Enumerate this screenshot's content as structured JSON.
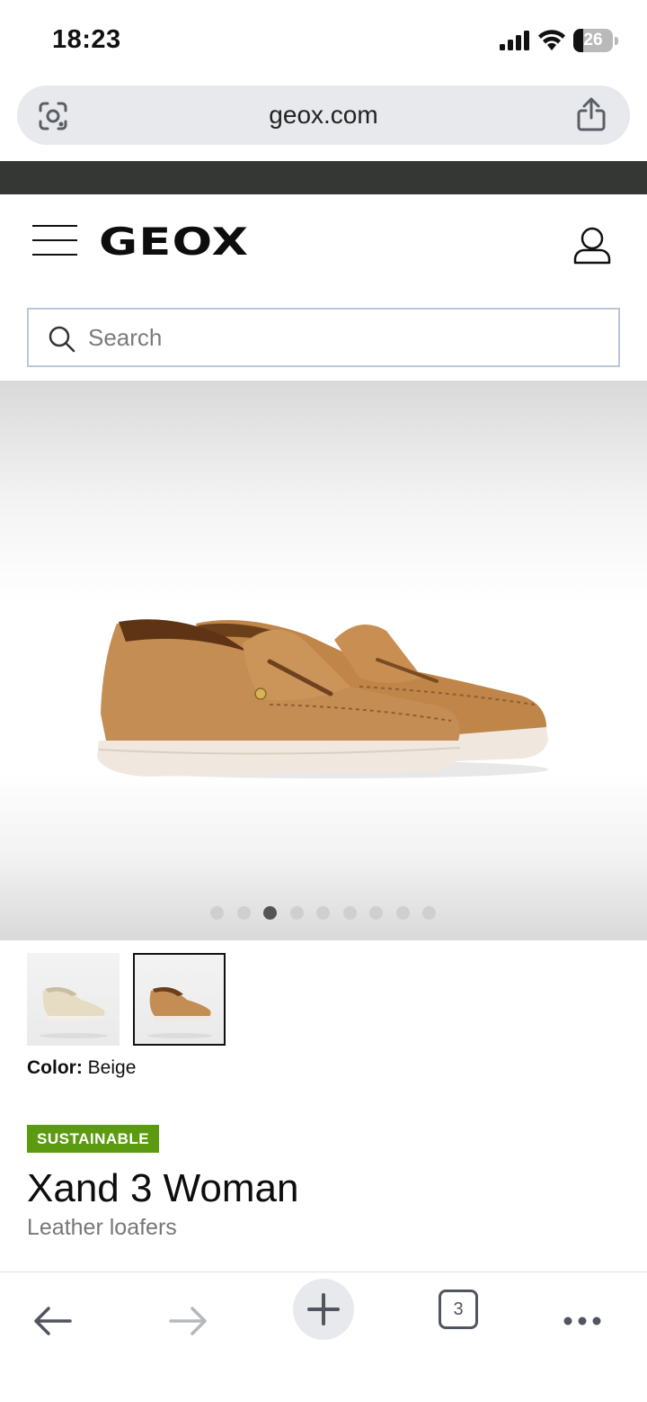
{
  "status_bar": {
    "time": "18:23",
    "battery_percent": "26",
    "battery_level": 0.26
  },
  "browser": {
    "url": "geox.com",
    "tabs_count": "3"
  },
  "header": {
    "logo": "GEOX"
  },
  "search": {
    "placeholder": "Search"
  },
  "gallery": {
    "dot_count": 9,
    "active_index": 2
  },
  "product": {
    "color_label": "Color:",
    "color_value": "Beige",
    "badge": "SUSTAINABLE",
    "title": "Xand 3 Woman",
    "subtitle": "Leather loafers"
  },
  "colors": {
    "promo_strip": "#343734",
    "badge_bg": "#5c9a12",
    "shoe_tan": "#c48d53",
    "sole": "#f0e8df"
  },
  "icons": [
    "google-lens-icon",
    "share-icon",
    "hamburger-icon",
    "account-icon",
    "search-icon",
    "back-arrow-icon",
    "forward-arrow-icon",
    "plus-icon",
    "more-icon"
  ]
}
